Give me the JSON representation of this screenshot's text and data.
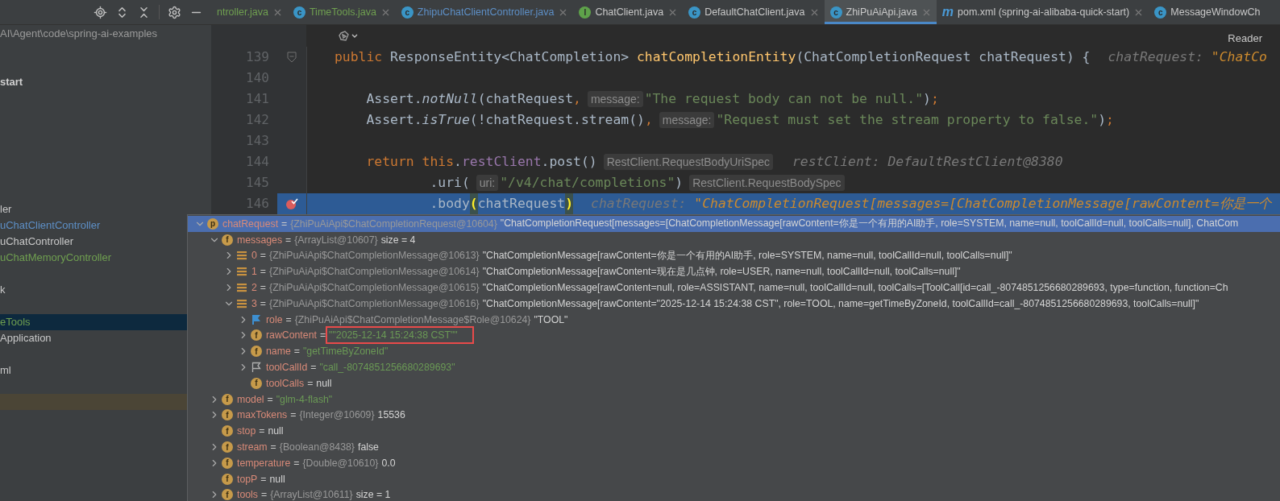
{
  "tabs": [
    {
      "label": "ntroller.java",
      "kind": "none",
      "color": "#6f9f50",
      "selected": false,
      "closable": true
    },
    {
      "label": "TimeTools.java",
      "kind": "class",
      "icon_letter": "c",
      "color": "#6f9f50",
      "selected": false,
      "closable": true
    },
    {
      "label": "ZhipuChatClientController.java",
      "kind": "class",
      "icon_letter": "c",
      "color": "#5d8fc6",
      "selected": false,
      "closable": true
    },
    {
      "label": "ChatClient.java",
      "kind": "interface",
      "icon_letter": "I",
      "color": "#c8c8c8",
      "selected": false,
      "closable": true
    },
    {
      "label": "DefaultChatClient.java",
      "kind": "class",
      "icon_letter": "c",
      "color": "#c8c8c8",
      "selected": false,
      "closable": true
    },
    {
      "label": "ZhiPuAiApi.java",
      "kind": "class",
      "icon_letter": "c",
      "color": "#c8c8c8",
      "selected": true,
      "closable": true
    },
    {
      "label": "pom.xml (spring-ai-alibaba-quick-start)",
      "kind": "maven",
      "icon_letter": "m",
      "color": "#c8c8c8",
      "selected": false,
      "closable": true
    },
    {
      "label": "MessageWindowCh",
      "kind": "class",
      "icon_letter": "c",
      "color": "#c8c8c8",
      "selected": false,
      "closable": false
    }
  ],
  "sidebar": {
    "path": "AI\\Agent\\code\\spring-ai-examples",
    "items": [
      {
        "label": "start",
        "bold": true,
        "color": "#d0d0d0",
        "selected": false
      },
      {
        "label": "ler",
        "bold": false,
        "color": "#c8c8c8",
        "selected": false
      },
      {
        "label": "uChatClientController",
        "bold": false,
        "color": "#5d8fc6",
        "selected": false
      },
      {
        "label": "uChatController",
        "bold": false,
        "color": "#c8c8c8",
        "selected": false
      },
      {
        "label": "uChatMemoryController",
        "bold": false,
        "color": "#6f9f50",
        "selected": false
      },
      {
        "label": "k",
        "bold": false,
        "color": "#c8c8c8",
        "selected": false
      },
      {
        "label": "eTools",
        "bold": false,
        "color": "#6f9f50",
        "selected": true
      },
      {
        "label": "Application",
        "bold": false,
        "color": "#c8c8c8",
        "selected": false
      },
      {
        "label": "ml",
        "bold": false,
        "color": "#c8c8c8",
        "selected": false
      }
    ]
  },
  "editor": {
    "reader_mode": "Reader",
    "lines": [
      {
        "number": "139",
        "kind": "signature",
        "fold": true,
        "breakpoint": false,
        "current": false,
        "tokens": [
          {
            "kind": "kw",
            "text": "public "
          },
          {
            "kind": "plain",
            "text": "ResponseEntity<ChatCompletion> "
          },
          {
            "kind": "fn",
            "text": "chatCompletionEntity"
          },
          {
            "kind": "plain",
            "text": "(ChatCompletionRequest chatRequest) {"
          },
          {
            "kind": "debug",
            "text": "chatRequest: "
          },
          {
            "kind": "debugval",
            "text": "\"ChatCo"
          }
        ]
      },
      {
        "number": "140",
        "kind": "blank",
        "fold": false,
        "breakpoint": false,
        "current": false
      },
      {
        "number": "141",
        "kind": "statement",
        "fold": false,
        "breakpoint": false,
        "current": false,
        "tokens": [
          {
            "kind": "plain",
            "text": "Assert."
          },
          {
            "kind": "italic",
            "text": "notNull"
          },
          {
            "kind": "plain",
            "text": "(chatRequest"
          },
          {
            "kind": "kw",
            "text": ","
          },
          {
            "kind": "hint",
            "text": "message:"
          },
          {
            "kind": "str",
            "text": "\"The request body can not be null.\""
          },
          {
            "kind": "plain",
            "text": ")"
          },
          {
            "kind": "kw",
            "text": ";"
          }
        ]
      },
      {
        "number": "142",
        "kind": "statement",
        "fold": false,
        "breakpoint": false,
        "current": false,
        "tokens": [
          {
            "kind": "plain",
            "text": "Assert."
          },
          {
            "kind": "italic",
            "text": "isTrue"
          },
          {
            "kind": "plain",
            "text": "(!chatRequest.stream()"
          },
          {
            "kind": "kw",
            "text": ","
          },
          {
            "kind": "hint",
            "text": "message:"
          },
          {
            "kind": "str",
            "text": "\"Request must set the stream property to false.\""
          },
          {
            "kind": "plain",
            "text": ")"
          },
          {
            "kind": "kw",
            "text": ";"
          }
        ]
      },
      {
        "number": "143",
        "kind": "blank",
        "fold": false,
        "breakpoint": false,
        "current": false
      },
      {
        "number": "144",
        "kind": "statement",
        "fold": false,
        "breakpoint": false,
        "current": false,
        "tokens": [
          {
            "kind": "kw",
            "text": "return this"
          },
          {
            "kind": "plain",
            "text": "."
          },
          {
            "kind": "field",
            "text": "restClient"
          },
          {
            "kind": "plain",
            "text": ".post()"
          },
          {
            "kind": "hint",
            "text": "RestClient.RequestBodyUriSpec"
          },
          {
            "kind": "debug",
            "text": "restClient: DefaultRestClient@8380"
          }
        ]
      },
      {
        "number": "145",
        "kind": "chain",
        "fold": false,
        "breakpoint": false,
        "current": false,
        "tokens": [
          {
            "kind": "plain",
            "text": ".uri("
          },
          {
            "kind": "hint",
            "text": "uri:"
          },
          {
            "kind": "str",
            "text": "\"/v4/chat/completions\""
          },
          {
            "kind": "plain",
            "text": ")"
          },
          {
            "kind": "hint",
            "text": "RestClient.RequestBodySpec"
          }
        ]
      },
      {
        "number": "146",
        "kind": "chain",
        "fold": false,
        "breakpoint": true,
        "current": true,
        "tokens": [
          {
            "kind": "plain",
            "text": ".body"
          },
          {
            "kind": "match",
            "text": "("
          },
          {
            "kind": "plain",
            "text": "chatRequest"
          },
          {
            "kind": "match",
            "text": ")"
          },
          {
            "kind": "debug",
            "text": "chatRequest: "
          },
          {
            "kind": "debugval",
            "text": "\"ChatCompletionRequest[messages=[ChatCompletionMessage[rawContent=你是一个"
          }
        ]
      }
    ]
  },
  "debug_tree": [
    {
      "badge": "p",
      "kind": "param",
      "name": "chatRequest",
      "sep": "=",
      "type": "{ZhiPuAiApi$ChatCompletionRequest@10604}",
      "value": "\"ChatCompletionRequest[messages=[ChatCompletionMessage[rawContent=你是一个有用的AI助手, role=SYSTEM, name=null, toolCallId=null, toolCalls=null], ChatCom",
      "string_value": false,
      "leaf": false,
      "expanded": true,
      "selected": true,
      "annotated": false,
      "children": [
        {
          "badge": "f",
          "kind": "field",
          "name": "messages",
          "sep": "=",
          "type": "{ArrayList@10607}",
          "value": "size = 4",
          "string_value": false,
          "leaf": false,
          "expanded": true,
          "selected": false,
          "annotated": false,
          "children": [
            {
              "kind": "list",
              "name": "0",
              "sep": "=",
              "type": "{ZhiPuAiApi$ChatCompletionMessage@10613}",
              "value": "\"ChatCompletionMessage[rawContent=你是一个有用的AI助手, role=SYSTEM, name=null, toolCallId=null, toolCalls=null]\"",
              "string_value": false,
              "leaf": false,
              "expanded": false,
              "selected": false,
              "annotated": false
            },
            {
              "kind": "list",
              "name": "1",
              "sep": "=",
              "type": "{ZhiPuAiApi$ChatCompletionMessage@10614}",
              "value": "\"ChatCompletionMessage[rawContent=现在是几点钟, role=USER, name=null, toolCallId=null, toolCalls=null]\"",
              "string_value": false,
              "leaf": false,
              "expanded": false,
              "selected": false,
              "annotated": false
            },
            {
              "kind": "list",
              "name": "2",
              "sep": "=",
              "type": "{ZhiPuAiApi$ChatCompletionMessage@10615}",
              "value": "\"ChatCompletionMessage[rawContent=null, role=ASSISTANT, name=null, toolCallId=null, toolCalls=[ToolCall[id=call_-8074851256680289693, type=function, function=Ch",
              "string_value": false,
              "leaf": false,
              "expanded": false,
              "selected": false,
              "annotated": false
            },
            {
              "kind": "list",
              "name": "3",
              "sep": "=",
              "type": "{ZhiPuAiApi$ChatCompletionMessage@10616}",
              "value": "\"ChatCompletionMessage[rawContent=\"2025-12-14 15:24:38 CST\", role=TOOL, name=getTimeByZoneId, toolCallId=call_-8074851256680289693, toolCalls=null]\"",
              "string_value": false,
              "leaf": false,
              "expanded": true,
              "selected": false,
              "annotated": false,
              "children": [
                {
                  "kind": "flag",
                  "name": "role",
                  "sep": "=",
                  "type": "{ZhiPuAiApi$ChatCompletionMessage$Role@10624}",
                  "value": "\"TOOL\"",
                  "string_value": false,
                  "leaf": false,
                  "expanded": false,
                  "selected": false,
                  "annotated": false
                },
                {
                  "badge": "f",
                  "kind": "field",
                  "name": "rawContent",
                  "sep": "=",
                  "value": "\"\"2025-12-14 15:24:38 CST\"\"",
                  "string_value": true,
                  "leaf": false,
                  "expanded": false,
                  "selected": false,
                  "annotated": true
                },
                {
                  "badge": "f",
                  "kind": "field",
                  "name": "name",
                  "sep": "=",
                  "value": "\"getTimeByZoneId\"",
                  "string_value": true,
                  "leaf": false,
                  "expanded": false,
                  "selected": false,
                  "annotated": false
                },
                {
                  "kind": "flag-outline",
                  "name": "toolCallId",
                  "sep": "=",
                  "value": "\"call_-8074851256680289693\"",
                  "string_value": true,
                  "leaf": false,
                  "expanded": false,
                  "selected": false,
                  "annotated": false
                },
                {
                  "badge": "f",
                  "kind": "field",
                  "name": "toolCalls",
                  "sep": "=",
                  "value": "null",
                  "string_value": false,
                  "leaf": true,
                  "expanded": false,
                  "selected": false,
                  "annotated": false
                }
              ]
            }
          ]
        },
        {
          "badge": "f",
          "kind": "field",
          "name": "model",
          "sep": "=",
          "value": "\"glm-4-flash\"",
          "string_value": true,
          "leaf": false,
          "expanded": false,
          "selected": false,
          "annotated": false
        },
        {
          "badge": "f",
          "kind": "field",
          "name": "maxTokens",
          "sep": "=",
          "type": "{Integer@10609}",
          "value": "15536",
          "string_value": false,
          "leaf": false,
          "expanded": false,
          "selected": false,
          "annotated": false
        },
        {
          "badge": "f",
          "kind": "field",
          "name": "stop",
          "sep": "=",
          "value": "null",
          "string_value": false,
          "leaf": true,
          "expanded": false,
          "selected": false,
          "annotated": false
        },
        {
          "badge": "f",
          "kind": "field",
          "name": "stream",
          "sep": "=",
          "type": "{Boolean@8438}",
          "value": "false",
          "string_value": false,
          "leaf": false,
          "expanded": false,
          "selected": false,
          "annotated": false
        },
        {
          "badge": "f",
          "kind": "field",
          "name": "temperature",
          "sep": "=",
          "type": "{Double@10610}",
          "value": "0.0",
          "string_value": false,
          "leaf": false,
          "expanded": false,
          "selected": false,
          "annotated": false
        },
        {
          "badge": "f",
          "kind": "field",
          "name": "topP",
          "sep": "=",
          "value": "null",
          "string_value": false,
          "leaf": true,
          "expanded": false,
          "selected": false,
          "annotated": false
        },
        {
          "badge": "f",
          "kind": "field",
          "name": "tools",
          "sep": "=",
          "type": "{ArrayList@10611}",
          "value": "size = 1",
          "string_value": false,
          "leaf": false,
          "expanded": false,
          "selected": false,
          "annotated": false
        }
      ]
    }
  ]
}
